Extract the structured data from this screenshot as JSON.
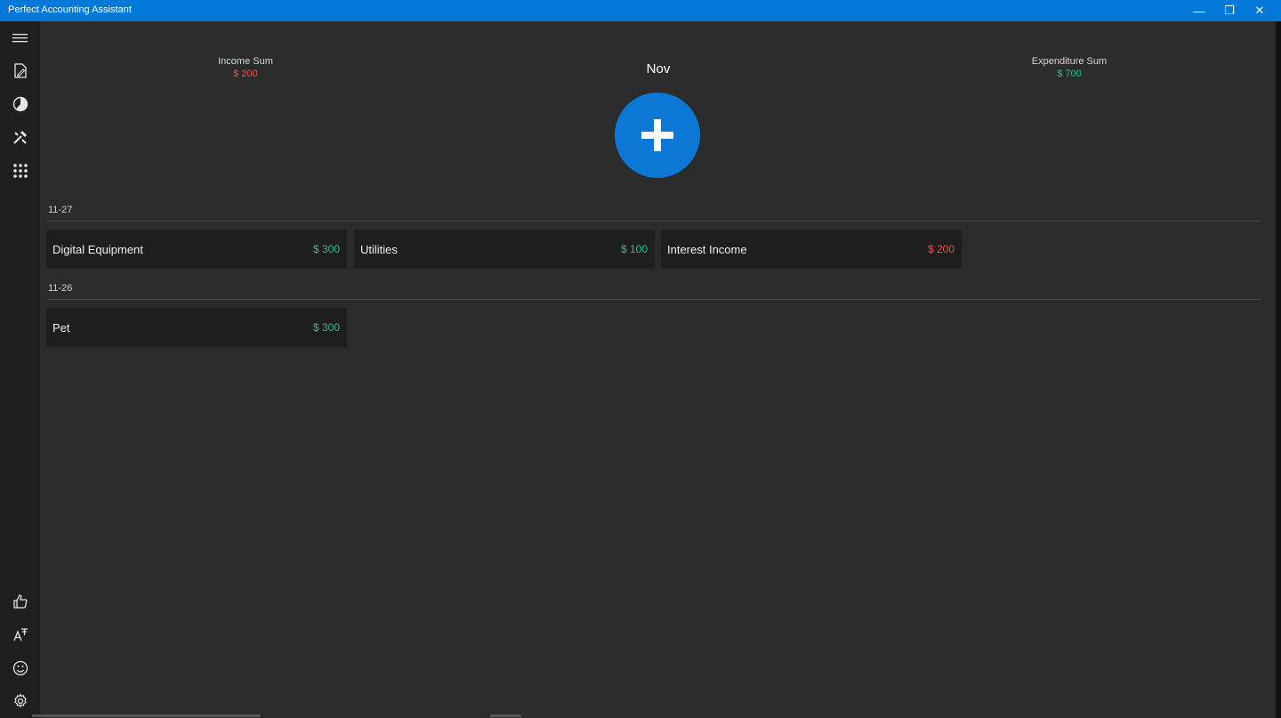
{
  "window": {
    "title": "Perfect Accounting Assistant",
    "controls": {
      "minimize": "—",
      "maximize": "❐",
      "close": "✕"
    }
  },
  "colors": {
    "accent": "#0078d7",
    "income": "#e8534a",
    "expense": "#2bbf8a"
  },
  "sidebar": {
    "top_items": [
      {
        "icon": "hamburger-menu-icon"
      },
      {
        "icon": "edit-document-icon"
      },
      {
        "icon": "pie-chart-icon"
      },
      {
        "icon": "tools-icon"
      },
      {
        "icon": "apps-grid-icon"
      }
    ],
    "bottom_items": [
      {
        "icon": "thumbs-up-icon"
      },
      {
        "icon": "font-size-icon"
      },
      {
        "icon": "smiley-icon"
      },
      {
        "icon": "gear-icon"
      }
    ]
  },
  "summary": {
    "income_label": "Income Sum",
    "income_value": "$ 200",
    "expenditure_label": "Expenditure Sum",
    "expenditure_value": "$ 700",
    "month": "Nov"
  },
  "groups": [
    {
      "date": "11-27",
      "items": [
        {
          "name": "Digital Equipment",
          "amount": "$ 300",
          "kind": "expense"
        },
        {
          "name": "Utilities",
          "amount": "$ 100",
          "kind": "expense"
        },
        {
          "name": "Interest Income",
          "amount": "$ 200",
          "kind": "income"
        }
      ]
    },
    {
      "date": "11-26",
      "items": [
        {
          "name": "Pet",
          "amount": "$ 300",
          "kind": "expense"
        }
      ]
    }
  ]
}
